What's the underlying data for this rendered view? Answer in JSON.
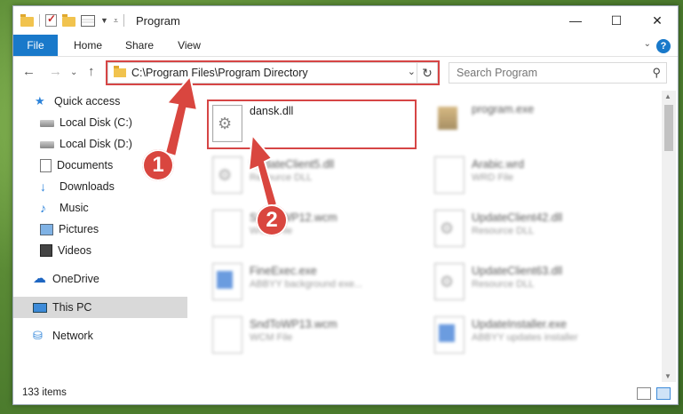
{
  "window": {
    "title": "Program"
  },
  "ribbon": {
    "tabs": [
      "File",
      "Home",
      "Share",
      "View"
    ]
  },
  "nav": {
    "address": "C:\\Program Files\\Program Directory",
    "search_placeholder": "Search Program"
  },
  "sidebar": {
    "items": [
      {
        "label": "Quick access",
        "icon": "star-icon",
        "pinned": false
      },
      {
        "label": "Local Disk (C:)",
        "icon": "disk-icon",
        "pinned": false
      },
      {
        "label": "Local Disk (D:)",
        "icon": "disk-icon",
        "pinned": true
      },
      {
        "label": "Documents",
        "icon": "documents-icon",
        "pinned": false
      },
      {
        "label": "Downloads",
        "icon": "downloads-icon",
        "pinned": true
      },
      {
        "label": "Music",
        "icon": "music-icon",
        "pinned": true
      },
      {
        "label": "Pictures",
        "icon": "pictures-icon",
        "pinned": true
      },
      {
        "label": "Videos",
        "icon": "videos-icon",
        "pinned": true
      },
      {
        "label": "OneDrive",
        "icon": "onedrive-icon",
        "pinned": false
      },
      {
        "label": "This PC",
        "icon": "pc-icon",
        "pinned": false,
        "selected": true
      },
      {
        "label": "Network",
        "icon": "network-icon",
        "pinned": false
      }
    ]
  },
  "files": [
    {
      "name": "dansk.dll",
      "type": "",
      "icon": "dll-icon"
    },
    {
      "name": "program.exe",
      "type": "",
      "icon": "program-icon"
    },
    {
      "name": "UpdateClient5.dll",
      "type": "Resource DLL",
      "icon": "dll-icon"
    },
    {
      "name": "Arabic.wrd",
      "type": "WRD File",
      "icon": "document-icon"
    },
    {
      "name": "SndToWP12.wcm",
      "type": "WCM File",
      "icon": "document-icon"
    },
    {
      "name": "UpdateClient42.dll",
      "type": "Resource DLL",
      "icon": "dll-icon"
    },
    {
      "name": "FineExec.exe",
      "type": "ABBYY background exe...",
      "icon": "exe-icon"
    },
    {
      "name": "UpdateClient63.dll",
      "type": "Resource DLL",
      "icon": "dll-icon"
    },
    {
      "name": "SndToWP13.wcm",
      "type": "WCM File",
      "icon": "document-icon"
    },
    {
      "name": "UpdateInstaller.exe",
      "type": "ABBYY updates installer",
      "icon": "exe-icon"
    }
  ],
  "status": {
    "count": "133 items"
  },
  "annotations": {
    "badge1": "1",
    "badge2": "2",
    "accent": "#d64545"
  }
}
